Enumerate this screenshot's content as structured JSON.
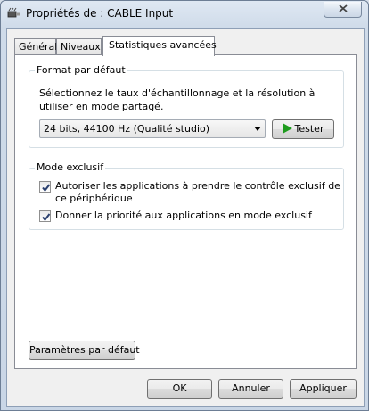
{
  "window": {
    "title": "Propriétés de : CABLE Input"
  },
  "tabs": [
    {
      "label": "Général"
    },
    {
      "label": "Niveaux"
    },
    {
      "label": "Statistiques avancées"
    }
  ],
  "format_group": {
    "label": "Format par défaut",
    "description": "Sélectionnez le taux d'échantillonnage et la résolution à utiliser en mode partagé.",
    "selected_format": "24 bits, 44100 Hz (Qualité studio)",
    "test_button": "Tester"
  },
  "exclusive_group": {
    "label": "Mode exclusif",
    "options": [
      {
        "label": "Autoriser les applications à prendre le contrôle exclusif de ce périphérique",
        "checked": true
      },
      {
        "label": "Donner la priorité aux applications en mode exclusif",
        "checked": true
      }
    ]
  },
  "defaults_button": "Paramètres par défaut",
  "footer": {
    "ok": "OK",
    "cancel": "Annuler",
    "apply": "Appliquer"
  },
  "icons": {
    "title": "speaker-jack-icon",
    "close": "close-icon",
    "play": "play-icon"
  },
  "colors": {
    "play_green": "#1d9b1d",
    "frame": "#d6dfea"
  }
}
